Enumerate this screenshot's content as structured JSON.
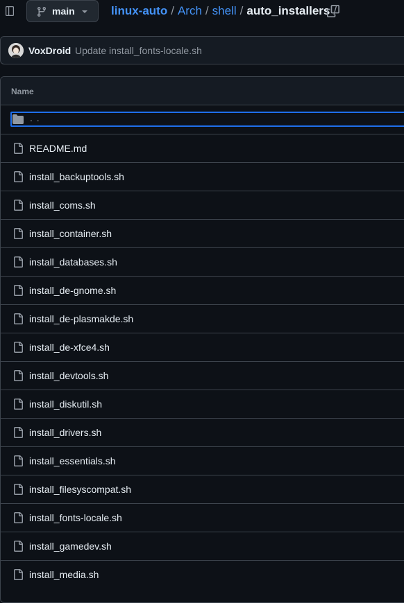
{
  "branch": {
    "label": "main"
  },
  "breadcrumb": {
    "repo": "linux-auto",
    "parts": [
      "Arch",
      "shell"
    ],
    "current": "auto_installers",
    "separator": "/"
  },
  "commit": {
    "author": "VoxDroid",
    "message": "Update install_fonts-locale.sh"
  },
  "table": {
    "column_name": "Name",
    "parent_label": ". .",
    "files": [
      "README.md",
      "install_backuptools.sh",
      "install_coms.sh",
      "install_container.sh",
      "install_databases.sh",
      "install_de-gnome.sh",
      "install_de-plasmakde.sh",
      "install_de-xfce4.sh",
      "install_devtools.sh",
      "install_diskutil.sh",
      "install_drivers.sh",
      "install_essentials.sh",
      "install_filesyscompat.sh",
      "install_fonts-locale.sh",
      "install_gamedev.sh",
      "install_media.sh"
    ]
  },
  "colors": {
    "background": "#0d1117",
    "link": "#4493f8",
    "focus": "#1f6feb",
    "border": "#3d444d"
  }
}
